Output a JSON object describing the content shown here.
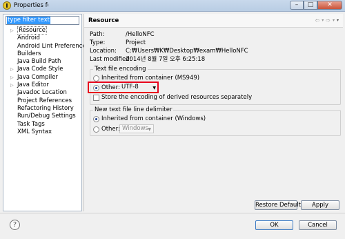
{
  "window": {
    "title": "Properties for"
  },
  "filter": {
    "value": "type filter text"
  },
  "tree": {
    "items": [
      {
        "label": "Resource",
        "expandable": true,
        "selected": true
      },
      {
        "label": "Android",
        "expandable": false
      },
      {
        "label": "Android Lint Preferences",
        "expandable": false
      },
      {
        "label": "Builders",
        "expandable": false
      },
      {
        "label": "Java Build Path",
        "expandable": false
      },
      {
        "label": "Java Code Style",
        "expandable": true
      },
      {
        "label": "Java Compiler",
        "expandable": true
      },
      {
        "label": "Java Editor",
        "expandable": true
      },
      {
        "label": "Javadoc Location",
        "expandable": false
      },
      {
        "label": "Project References",
        "expandable": false
      },
      {
        "label": "Refactoring History",
        "expandable": false
      },
      {
        "label": "Run/Debug Settings",
        "expandable": false
      },
      {
        "label": "Task Tags",
        "expandable": false
      },
      {
        "label": "XML Syntax",
        "expandable": false
      }
    ]
  },
  "page": {
    "title": "Resource",
    "nav": {
      "back": "⇦",
      "back_dd": "▾",
      "forward": "⇨",
      "forward_dd": "▾",
      "menu": "▾"
    },
    "properties": [
      {
        "label": "Path:",
        "value": "/HelloNFC"
      },
      {
        "label": "Type:",
        "value": "Project"
      },
      {
        "label": "Location:",
        "value": "C:₩Users₩K₩Desktop₩exam₩HelloNFC"
      },
      {
        "label": "Last modified:",
        "value": "2014년 8월 7일 오후 6:25:18"
      }
    ],
    "encoding": {
      "group_title": "Text file encoding",
      "inherited_label": "Inherited from container (MS949)",
      "other_label": "Other:",
      "other_value": "UTF-8",
      "store_label": "Store the encoding of derived resources separately"
    },
    "line_delimiter": {
      "group_title": "New text file line delimiter",
      "inherited_label": "Inherited from container (Windows)",
      "other_label": "Other:",
      "other_value": "Windows"
    },
    "restore_defaults": "Restore Defaults",
    "apply": "Apply"
  },
  "footer": {
    "help_icon": "?",
    "ok": "OK",
    "cancel": "Cancel"
  }
}
